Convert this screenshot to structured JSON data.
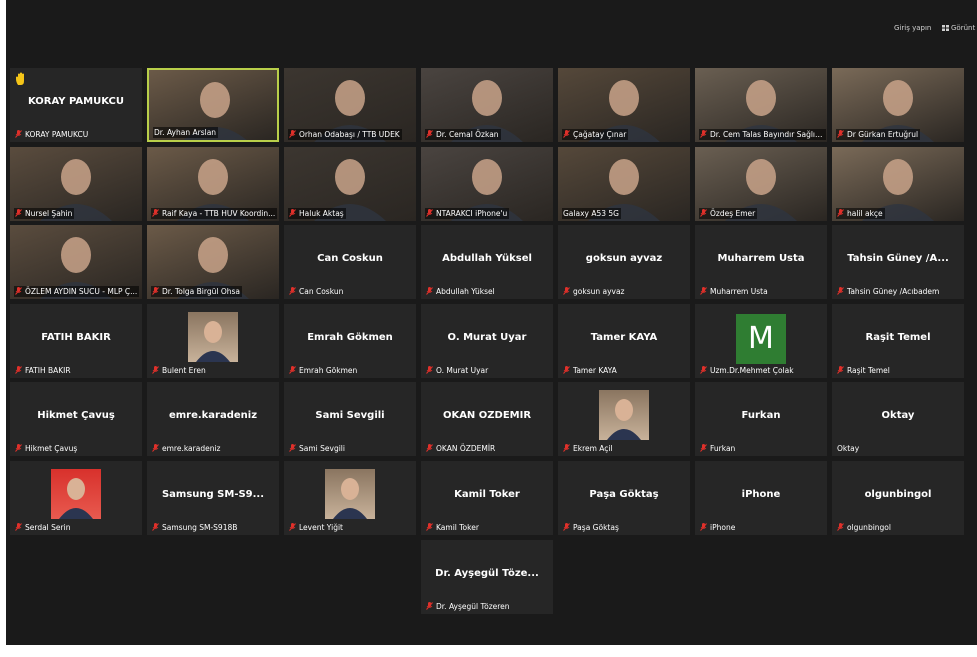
{
  "topbar": {
    "signin_label": "Giriş yapın",
    "view_label": "Görünt"
  },
  "colors": {
    "background": "#1a1a1a",
    "tile": "#262626",
    "active_border": "#b9cf4a",
    "muted_mic": "#e0302a"
  },
  "tiles": [
    {
      "label": "KORAY PAMUKCU",
      "center": "KORAY PAMUKCU",
      "hand": true,
      "mic_muted": true,
      "video": false
    },
    {
      "label": "Dr. Ayhan Arslan",
      "center": "",
      "video": true,
      "active": true,
      "mic_muted": false
    },
    {
      "label": "Orhan Odabaşı / TTB UDEK",
      "center": "",
      "video": true,
      "mic_muted": true
    },
    {
      "label": "Dr. Cemal Özkan",
      "center": "",
      "video": true,
      "mic_muted": true
    },
    {
      "label": "Çağatay Çınar",
      "center": "",
      "video": true,
      "mic_muted": true
    },
    {
      "label": "Dr. Cem Talas Bayındır Sağlık ...",
      "center": "",
      "video": true,
      "mic_muted": true
    },
    {
      "label": "Dr Gürkan Ertuğrul",
      "center": "",
      "video": true,
      "mic_muted": true
    },
    {
      "label": "Nursel Şahin",
      "center": "",
      "video": true,
      "mic_muted": true
    },
    {
      "label": "Raif Kaya - TTB HUV Koordin...",
      "center": "",
      "video": true,
      "mic_muted": true
    },
    {
      "label": "Haluk Aktaş",
      "center": "",
      "video": true,
      "mic_muted": true
    },
    {
      "label": "NTARAKCI iPhone'u",
      "center": "",
      "video": true,
      "mic_muted": true
    },
    {
      "label": "Galaxy A53 5G",
      "center": "",
      "video": true,
      "mic_muted": false
    },
    {
      "label": "Özdeş Emer",
      "center": "",
      "video": true,
      "mic_muted": true
    },
    {
      "label": "halil akçe",
      "center": "",
      "video": true,
      "mic_muted": true
    },
    {
      "label": "ÖZLEM AYDIN SUCU - MLP Ç...",
      "center": "",
      "video": true,
      "mic_muted": true
    },
    {
      "label": "Dr. Tolga Birgül Ohsa",
      "center": "",
      "video": true,
      "mic_muted": true
    },
    {
      "label": "Can Coskun",
      "center": "Can Coskun",
      "video": false,
      "mic_muted": true
    },
    {
      "label": "Abdullah Yüksel",
      "center": "Abdullah Yüksel",
      "video": false,
      "mic_muted": true
    },
    {
      "label": "goksun ayvaz",
      "center": "goksun ayvaz",
      "video": false,
      "mic_muted": true
    },
    {
      "label": "Muharrem Usta",
      "center": "Muharrem Usta",
      "video": false,
      "mic_muted": true
    },
    {
      "label": "Tahsin Güney /Acıbadem",
      "center": "Tahsin Güney /A...",
      "video": false,
      "mic_muted": true
    },
    {
      "label": "FATIH BAKIR",
      "center": "FATIH BAKIR",
      "video": false,
      "mic_muted": true
    },
    {
      "label": "Bulent Eren",
      "center": "",
      "photo": true,
      "video": false,
      "mic_muted": true
    },
    {
      "label": "Emrah Gökmen",
      "center": "Emrah Gökmen",
      "video": false,
      "mic_muted": true
    },
    {
      "label": "O. Murat Uyar",
      "center": "O. Murat Uyar",
      "video": false,
      "mic_muted": true
    },
    {
      "label": "Tamer KAYA",
      "center": "Tamer KAYA",
      "video": false,
      "mic_muted": true
    },
    {
      "label": "Uzm.Dr.Mehmet Çolak",
      "center": "",
      "letter": "M",
      "video": false,
      "mic_muted": true
    },
    {
      "label": "Raşit Temel",
      "center": "Raşit Temel",
      "video": false,
      "mic_muted": true
    },
    {
      "label": "Hikmet Çavuş",
      "center": "Hikmet Çavuş",
      "video": false,
      "mic_muted": true
    },
    {
      "label": "emre.karadeniz",
      "center": "emre.karadeniz",
      "video": false,
      "mic_muted": true
    },
    {
      "label": "Sami Sevgili",
      "center": "Sami Sevgili",
      "video": false,
      "mic_muted": true
    },
    {
      "label": "OKAN ÖZDEMİR",
      "center": "OKAN ÖZDEMİR",
      "video": false,
      "mic_muted": true
    },
    {
      "label": "Ekrem Açil",
      "center": "",
      "photo": true,
      "video": false,
      "mic_muted": true
    },
    {
      "label": "Furkan",
      "center": "Furkan",
      "video": false,
      "mic_muted": true
    },
    {
      "label": "Oktay",
      "center": "Oktay",
      "video": false,
      "mic_muted": false
    },
    {
      "label": "Serdal Serin",
      "center": "",
      "photo": true,
      "photo_red": true,
      "video": false,
      "mic_muted": true
    },
    {
      "label": "Samsung SM-S918B",
      "center": "Samsung  SM-S9...",
      "video": false,
      "mic_muted": true
    },
    {
      "label": "Levent Yiğit",
      "center": "",
      "photo": true,
      "video": false,
      "mic_muted": true
    },
    {
      "label": "Kamil Toker",
      "center": "Kamil Toker",
      "video": false,
      "mic_muted": true
    },
    {
      "label": "Paşa Göktaş",
      "center": "Paşa Göktaş",
      "video": false,
      "mic_muted": true
    },
    {
      "label": "iPhone",
      "center": "iPhone",
      "video": false,
      "mic_muted": true
    },
    {
      "label": "olgunbingol",
      "center": "olgunbingol",
      "video": false,
      "mic_muted": true
    },
    {
      "label": "Dr. Ayşegül Tözeren",
      "center": "Dr. Ayşegül Töze...",
      "video": false,
      "mic_muted": true
    }
  ]
}
